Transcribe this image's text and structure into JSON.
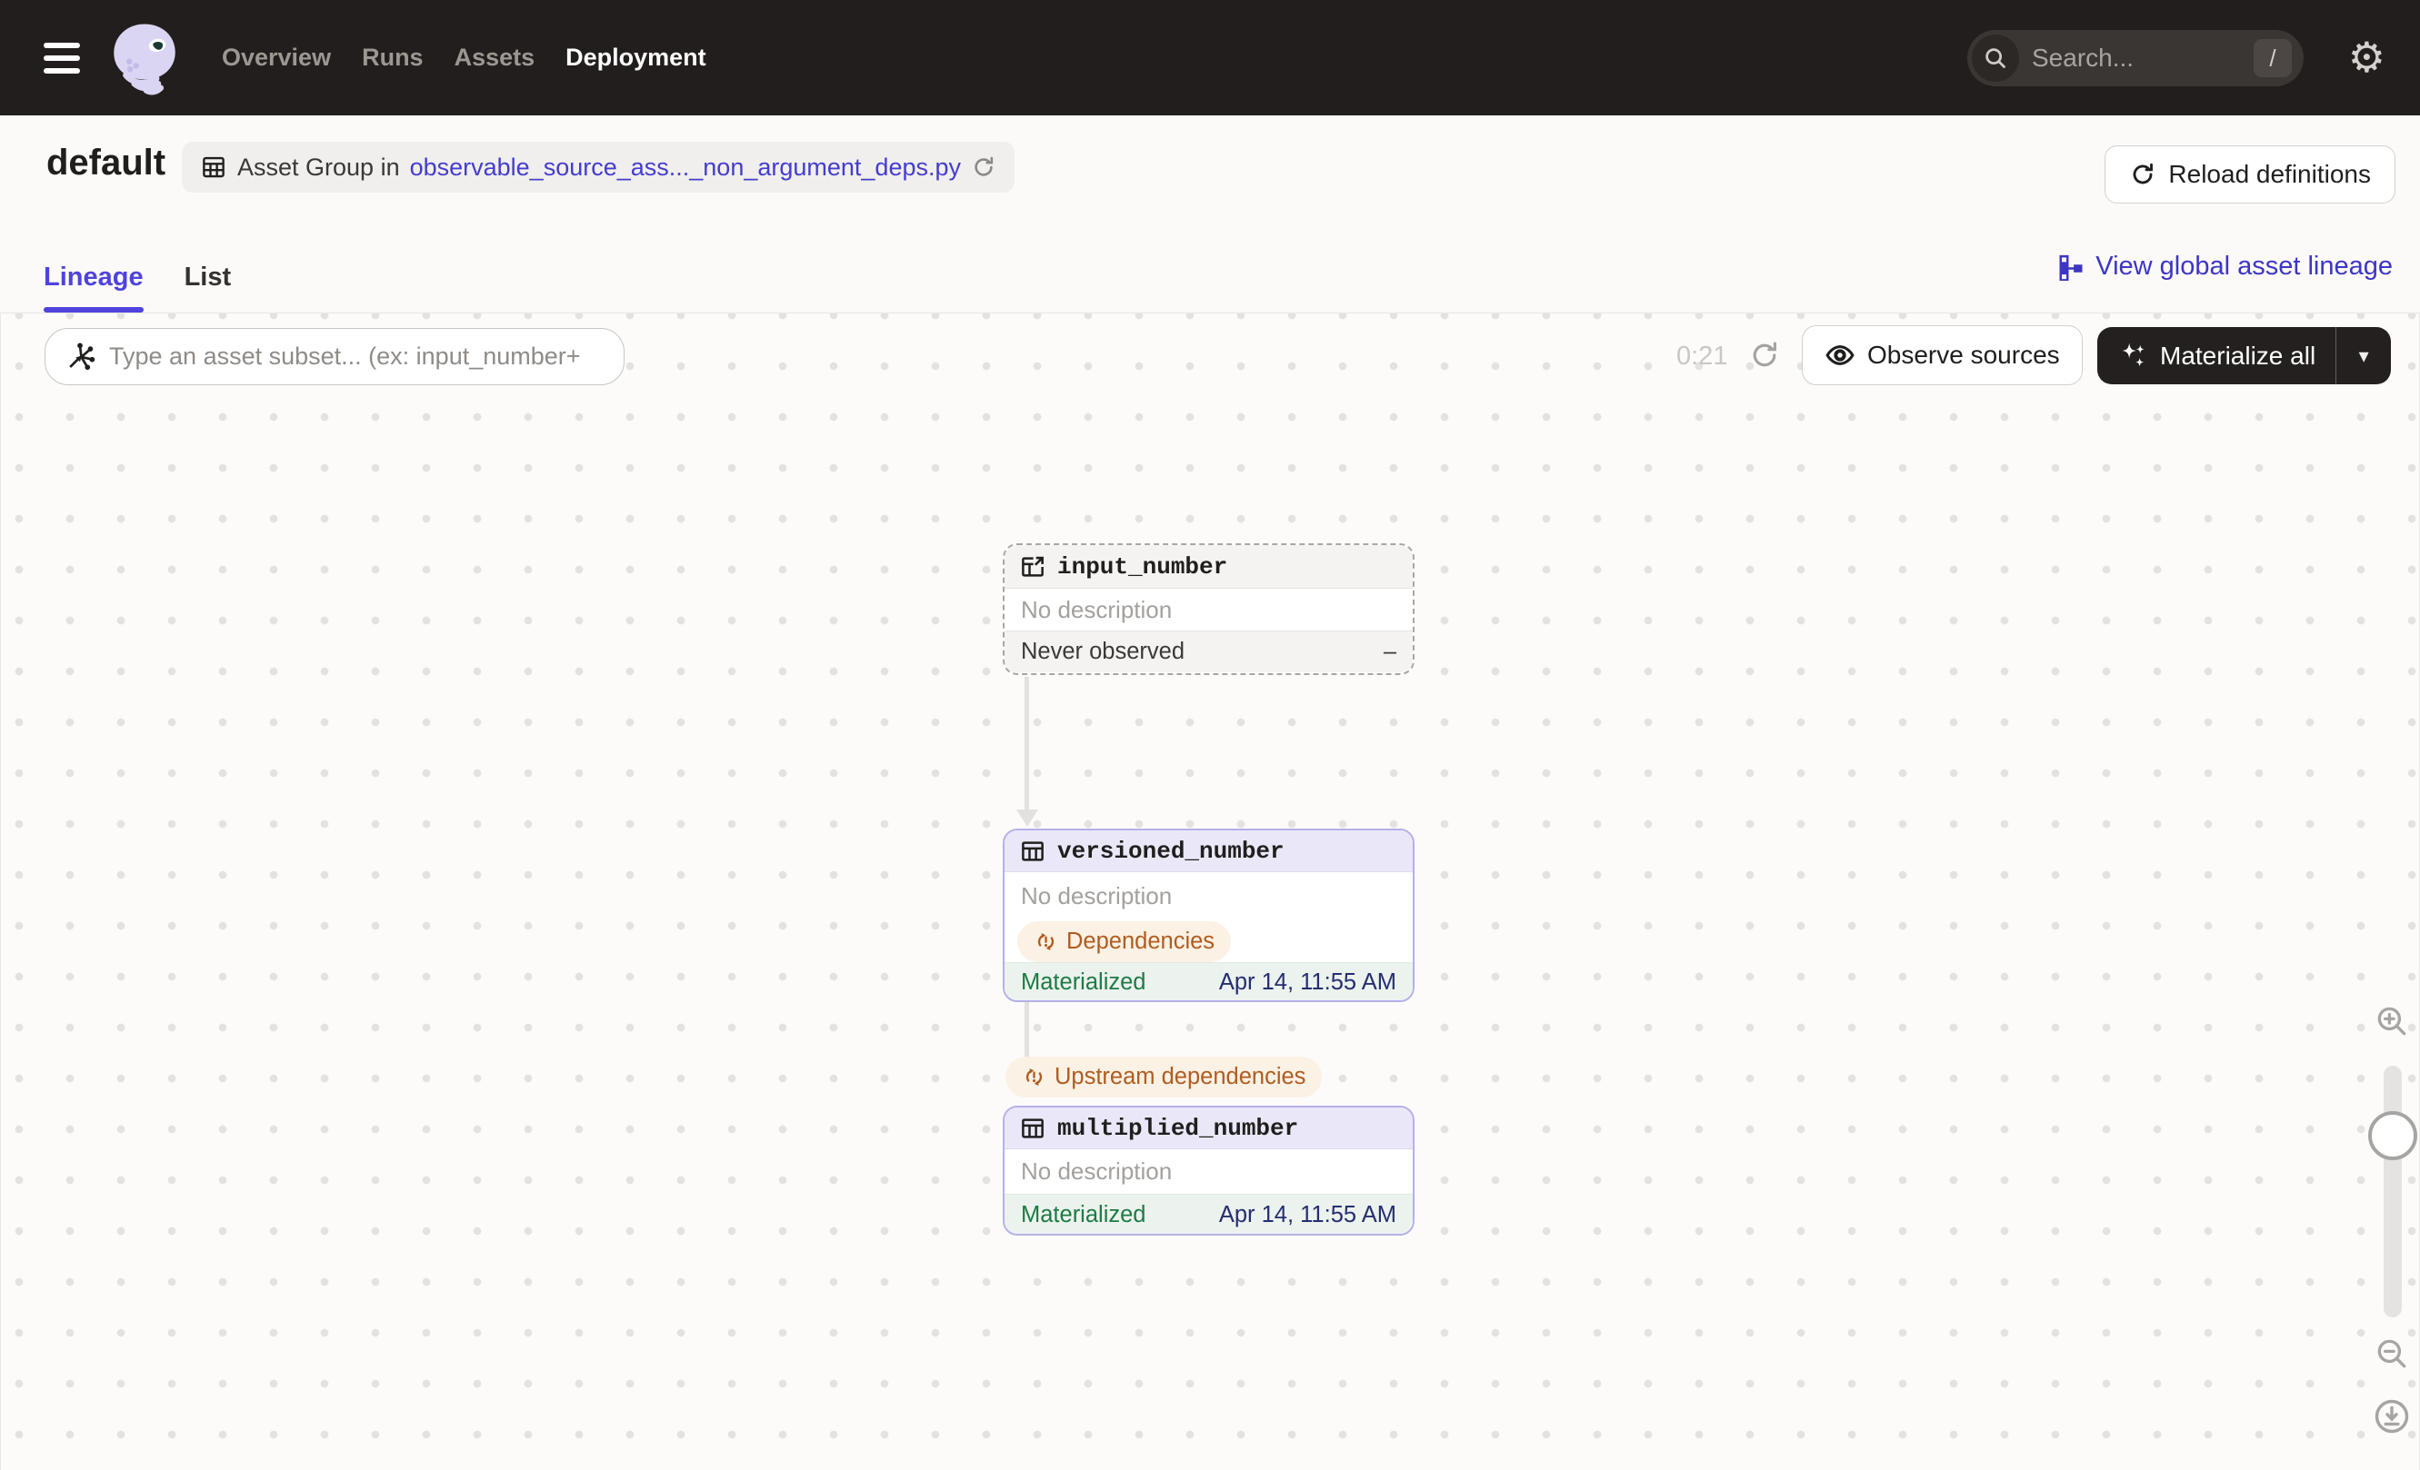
{
  "nav": {
    "items": [
      {
        "label": "Overview",
        "active": false
      },
      {
        "label": "Runs",
        "active": false
      },
      {
        "label": "Assets",
        "active": false
      },
      {
        "label": "Deployment",
        "active": true
      }
    ],
    "search_placeholder": "Search...",
    "search_shortcut": "/",
    "gear_glyph": "⚙"
  },
  "header": {
    "title": "default",
    "badge_prefix": "Asset Group in",
    "badge_link": "observable_source_ass..._non_argument_deps.py",
    "reload_label": "Reload definitions"
  },
  "tabs": {
    "lineage": "Lineage",
    "list": "List",
    "global_link": "View global asset lineage"
  },
  "toolbar": {
    "filter_placeholder": "Type an asset subset... (ex: input_number+",
    "timer": "0:21",
    "observe_label": "Observe sources",
    "materialize_label": "Materialize all",
    "caret_glyph": "▾"
  },
  "graph": {
    "input_node": {
      "name": "input_number",
      "description": "No description",
      "status_label": "Never observed",
      "status_value": "–"
    },
    "versioned_node": {
      "name": "versioned_number",
      "description": "No description",
      "chip": "Dependencies",
      "status_label": "Materialized",
      "status_value": "Apr 14, 11:55 AM"
    },
    "edge_chip": "Upstream dependencies",
    "multiplied_node": {
      "name": "multiplied_number",
      "description": "No description",
      "status_label": "Materialized",
      "status_value": "Apr 14, 11:55 AM"
    }
  },
  "colors": {
    "accent_indigo": "#4f43dd",
    "materialized_green": "#1d7b45",
    "warning_orange": "#b05c20",
    "lavender_border": "#b5b0e9",
    "dashed_border": "#a9a6a3",
    "timestamp_navy": "#252e70",
    "nav_background": "#221e1d"
  },
  "icons": [
    "menu-icon",
    "dagster-logo",
    "search-icon",
    "gear-icon",
    "table-icon",
    "source-table-icon",
    "refresh-icon",
    "lineage-icon",
    "graph-query-icon",
    "eye-icon",
    "sparkle-icon",
    "changed-dependencies-icon",
    "zoom-in-icon",
    "zoom-out-icon",
    "download-icon",
    "caret-down-icon"
  ]
}
